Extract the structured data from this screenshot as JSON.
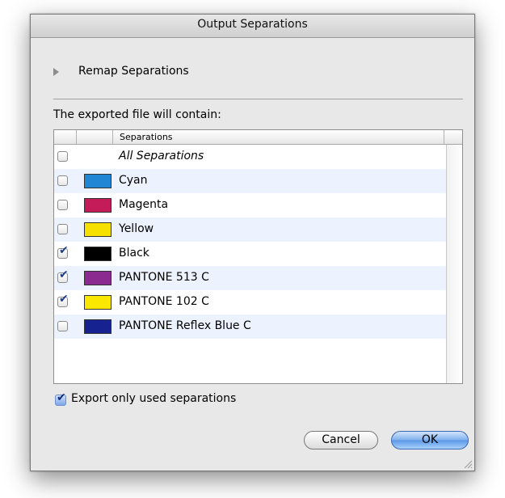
{
  "dialog": {
    "title": "Output Separations",
    "remap_label": "Remap Separations",
    "intro": "The exported file will contain:",
    "column_header": "Separations",
    "rows": [
      {
        "label": "All Separations",
        "checked": false,
        "swatch": null,
        "italic": true
      },
      {
        "label": "Cyan",
        "checked": false,
        "swatch": "#2186d4"
      },
      {
        "label": "Magenta",
        "checked": false,
        "swatch": "#c41c59"
      },
      {
        "label": "Yellow",
        "checked": false,
        "swatch": "#f5e000"
      },
      {
        "label": "Black",
        "checked": true,
        "swatch": "#000000"
      },
      {
        "label": "PANTONE 513 C",
        "checked": true,
        "swatch": "#8b2a8f"
      },
      {
        "label": "PANTONE 102 C",
        "checked": true,
        "swatch": "#fbe800"
      },
      {
        "label": "PANTONE Reflex Blue C",
        "checked": false,
        "swatch": "#15228f"
      }
    ],
    "export_only_used": {
      "label": "Export only used separations",
      "checked": true
    },
    "buttons": {
      "cancel": "Cancel",
      "ok": "OK"
    }
  }
}
